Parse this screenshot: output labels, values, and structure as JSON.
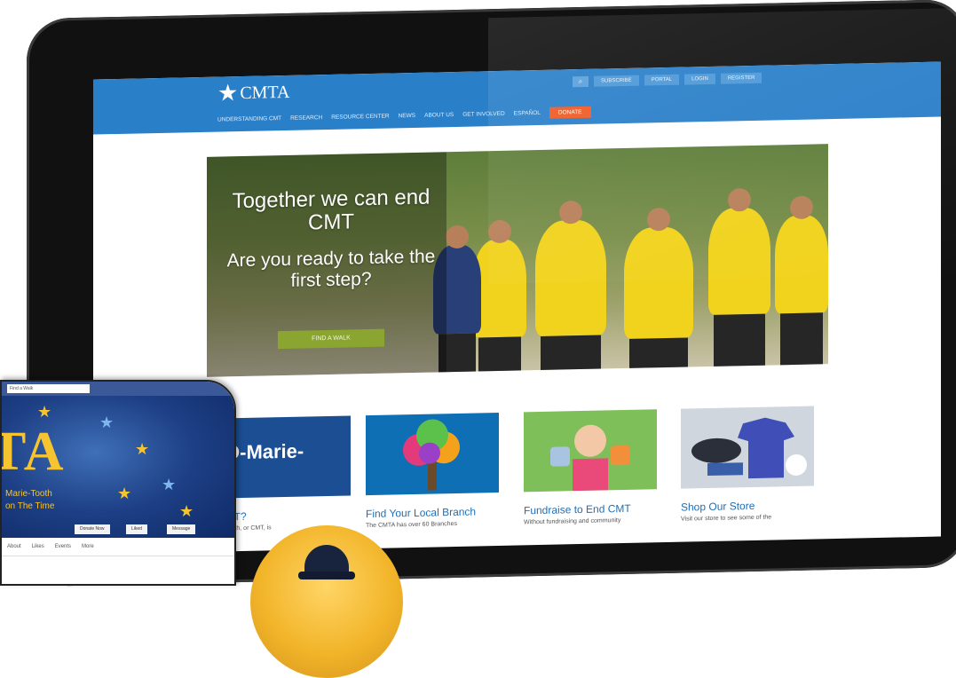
{
  "site": {
    "logo_text": "CMTA",
    "top_links": [
      "SUBSCRIBE",
      "PORTAL",
      "LOGIN",
      "REGISTER"
    ],
    "nav": [
      "UNDERSTANDING CMT",
      "RESEARCH",
      "RESOURCE CENTER",
      "NEWS",
      "ABOUT US",
      "GET INVOLVED",
      "ESPAÑOL"
    ],
    "donate_label": "DONATE",
    "colors": {
      "header": "#2a7fc9",
      "donate": "#f05a23",
      "cta": "#8aa530",
      "link": "#1f6fb7"
    }
  },
  "hero": {
    "headline": "Together we can end CMT",
    "subhead": "Are you ready to take the first step?",
    "cta_label": "FIND A WALK"
  },
  "cards": [
    {
      "title": "CMT?",
      "desc": "...-Tooth, or CMT, is",
      "img_text": "O-Marie-"
    },
    {
      "title": "Find Your Local Branch",
      "desc": "The CMTA has over 60 Branches"
    },
    {
      "title": "Fundraise to End CMT",
      "desc": "Without fundraising and community"
    },
    {
      "title": "Shop Our Store",
      "desc": "Visit our store to see some of the"
    }
  ],
  "facebook": {
    "search_placeholder": "Find a Walk",
    "cover_logo": "TA",
    "cover_sub_1": "Marie-Tooth",
    "cover_sub_2": "on The Time",
    "buttons": [
      "Donate Now",
      "Liked",
      "Message"
    ],
    "tabs": [
      "About",
      "Likes",
      "Events",
      "More"
    ]
  }
}
